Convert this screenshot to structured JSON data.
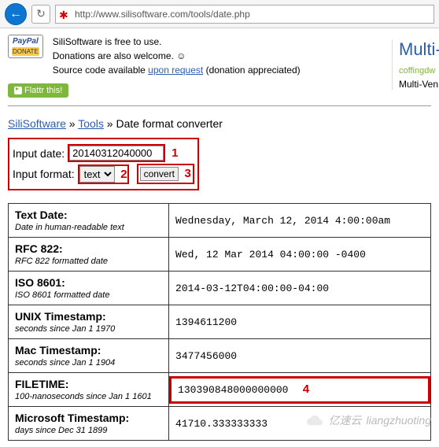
{
  "browser": {
    "url": "http://www.silisoftware.com/tools/date.php"
  },
  "intro": {
    "line1": "SiliSoftware is free to use.",
    "line2a": "Donations are also welcome. ",
    "smiley": "☺",
    "line3a": "Source code available ",
    "line3link": "upon request",
    "line3b": " (donation appreciated)",
    "flattr": "Flattr this!",
    "paypal": "PayPal",
    "donate": "DONATE"
  },
  "rightcol": {
    "multi": "Multi-",
    "coffing": "coffingdw",
    "multiven": "Multi-Ven"
  },
  "breadcrumb": {
    "a": "SiliSoftware",
    "b": "Tools",
    "c": "Date format converter"
  },
  "form": {
    "input_date_label": "Input date:",
    "input_date_value": "20140312040000",
    "input_format_label": "Input format:",
    "input_format_value": "text",
    "convert": "convert",
    "annot1": "1",
    "annot2": "2",
    "annot3": "3",
    "annot4": "4"
  },
  "rows": [
    {
      "title": "Text Date:",
      "sub": "Date in human-readable text",
      "val": "Wednesday, March 12, 2014 4:00:00am"
    },
    {
      "title": "RFC 822:",
      "sub": "RFC 822 formatted date",
      "val": "Wed, 12 Mar 2014 04:00:00 -0400"
    },
    {
      "title": "ISO 8601:",
      "sub": "ISO 8601 formatted date",
      "val": "2014-03-12T04:00:00-04:00"
    },
    {
      "title": "UNIX Timestamp:",
      "sub": "seconds since Jan 1 1970",
      "val": "1394611200"
    },
    {
      "title": "Mac Timestamp:",
      "sub": "seconds since Jan 1 1904",
      "val": "3477456000"
    },
    {
      "title": "FILETIME:",
      "sub": "100-nanoseconds since Jan 1 1601",
      "val": "130390848000000000"
    },
    {
      "title": "Microsoft Timestamp:",
      "sub": "days since Dec 31 1899",
      "val": "41710.333333333"
    }
  ],
  "watermark": {
    "text": "liangzhuoting",
    "brand": "亿速云"
  }
}
